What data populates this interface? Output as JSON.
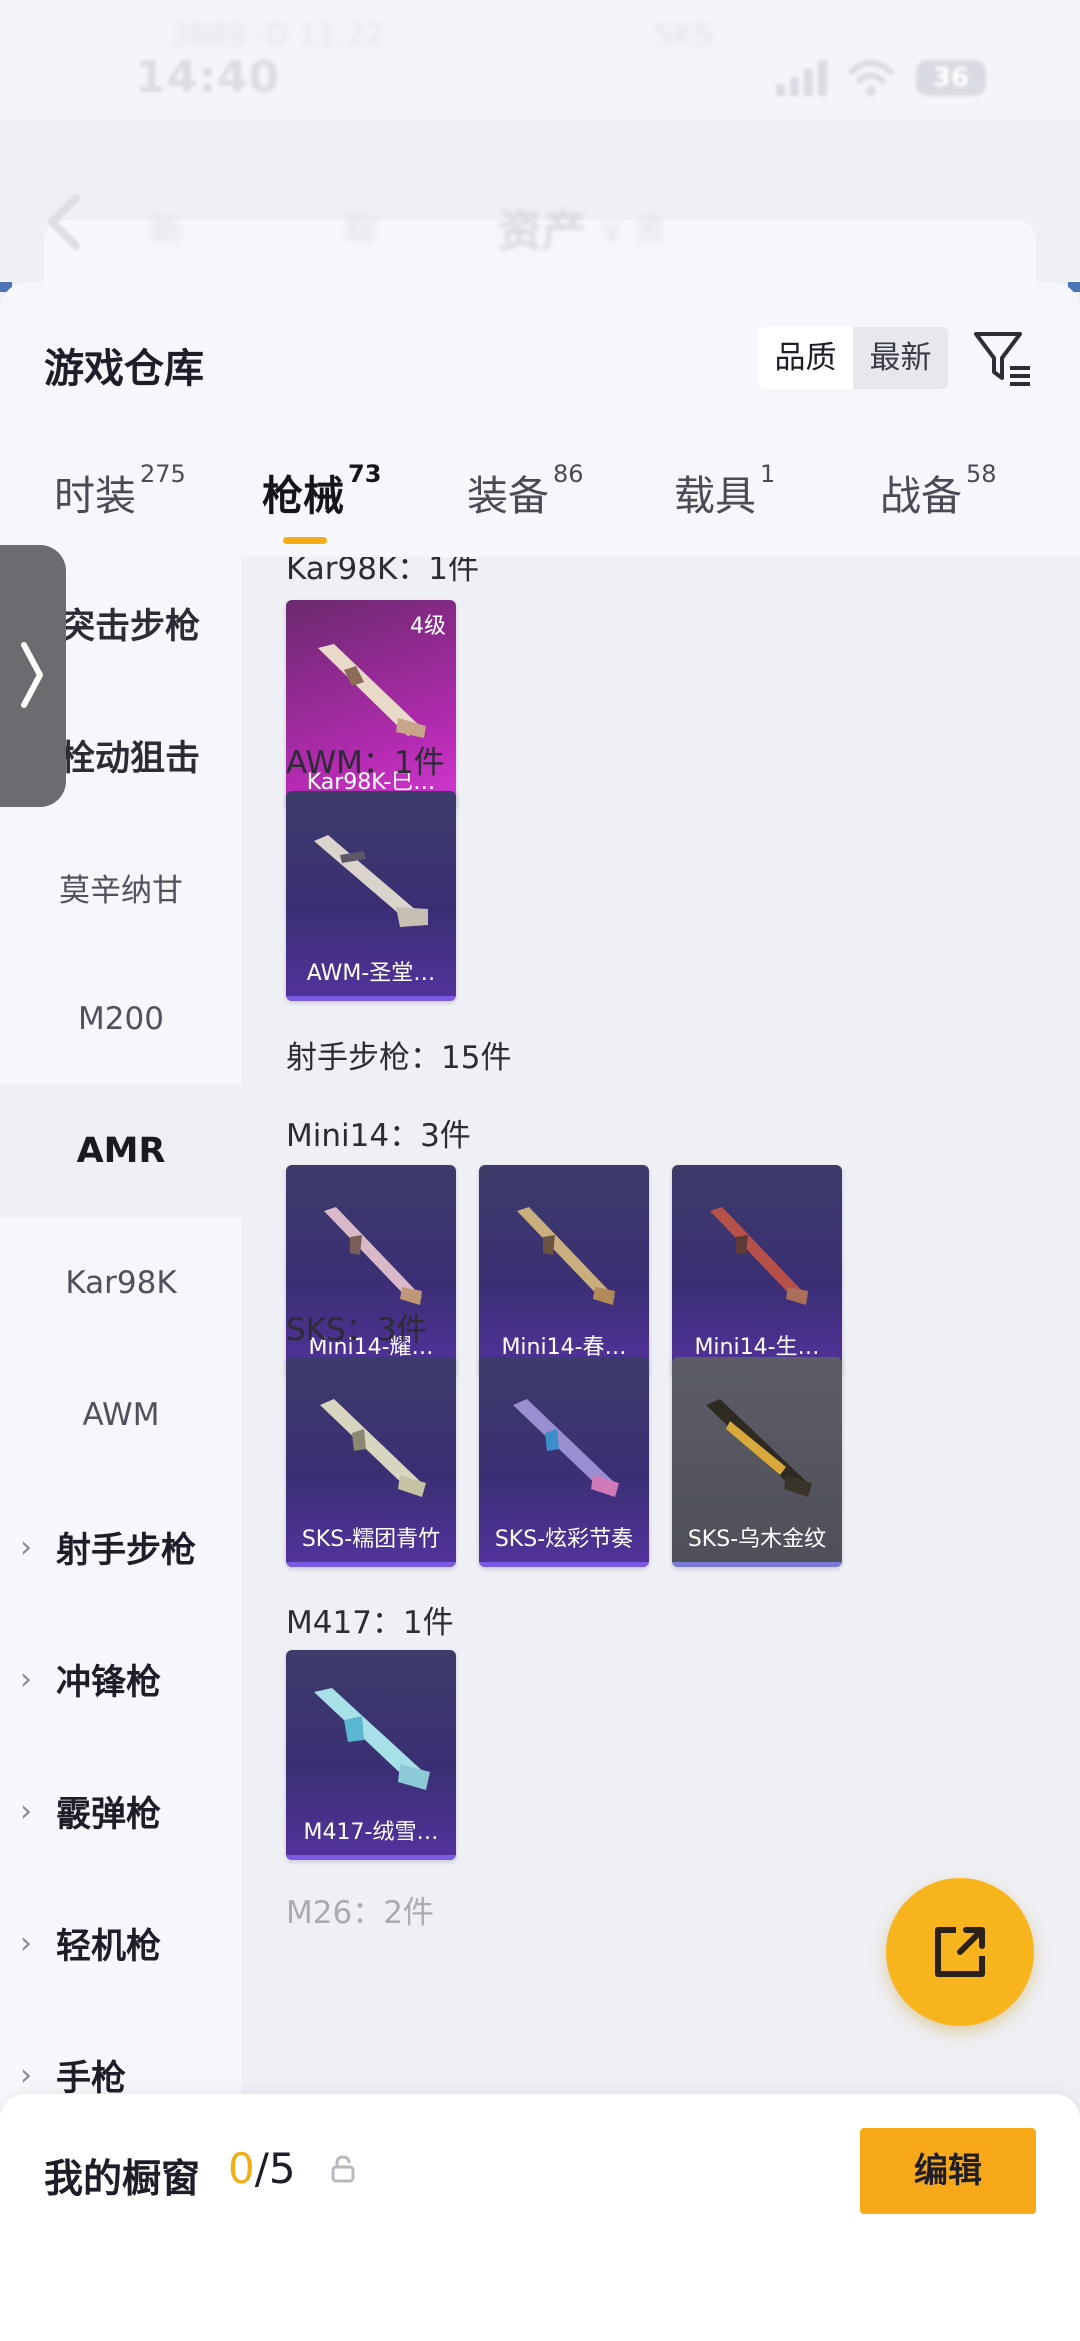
{
  "status_bar": {
    "time": "14:40",
    "battery": "36",
    "ghost_left": "3889 ·D 11:22",
    "ghost_right": "SKS"
  },
  "nav_bar": {
    "title": "资产",
    "ghost_items": [
      "新",
      "聊",
      "∨ 资"
    ]
  },
  "header": {
    "title": "游戏仓库",
    "sort_options": [
      "品质",
      "最新"
    ],
    "active_sort": "品质"
  },
  "tabs": [
    {
      "label": "时装",
      "count": "275"
    },
    {
      "label": "枪械",
      "count": "73"
    },
    {
      "label": "装备",
      "count": "86"
    },
    {
      "label": "载具",
      "count": "1"
    },
    {
      "label": "战备",
      "count": "58"
    }
  ],
  "active_tab": "枪械",
  "categories": {
    "top_groups": [
      "突击步枪",
      "栓动狙击"
    ],
    "sub_items_1": [
      "莫辛纳甘",
      "M200"
    ],
    "selected": "AMR",
    "sub_items_2": [
      "Kar98K",
      "AWM"
    ],
    "groups": [
      "射手步枪",
      "冲锋枪",
      "霰弹枪",
      "轻机枪",
      "手枪"
    ],
    "chevron": "›"
  },
  "content": {
    "groups": [
      {
        "label": "Kar98K：1件",
        "items": [
          {
            "name": "Kar98K-巳…",
            "level": "4级",
            "style": "pink"
          }
        ]
      },
      {
        "label": "AWM：1件",
        "items": [
          {
            "name": "AWM-圣堂…",
            "style": "purple"
          }
        ]
      },
      {
        "label": "射手步枪：15件",
        "items": []
      },
      {
        "label": "Mini14：3件",
        "items": [
          {
            "name": "Mini14-耀…",
            "style": "purple"
          },
          {
            "name": "Mini14-春…",
            "style": "purple"
          },
          {
            "name": "Mini14-生…",
            "style": "purple"
          }
        ]
      },
      {
        "label": "SKS：3件",
        "items": [
          {
            "name": "SKS-糯团青竹",
            "style": "purple"
          },
          {
            "name": "SKS-炫彩节奏",
            "style": "purple"
          },
          {
            "name": "SKS-乌木金纹",
            "style": "gray"
          }
        ]
      },
      {
        "label": "M417：1件",
        "items": [
          {
            "name": "M417-绒雪…",
            "style": "purple"
          }
        ]
      },
      {
        "label": "M26：2件",
        "items": []
      }
    ]
  },
  "bottom_bar": {
    "title": "我的橱窗",
    "current": "0",
    "total": "/5",
    "edit_label": "编辑"
  },
  "icons": {
    "filter": "filter-icon",
    "share": "share-icon",
    "lock": "lock-icon",
    "drawer": "chevron-right-icon"
  },
  "colors": {
    "accent": "#f4ad16",
    "edit_button": "#f7a91a",
    "rare_card": "#b52bb2",
    "epic_card": "#3a2f73"
  }
}
